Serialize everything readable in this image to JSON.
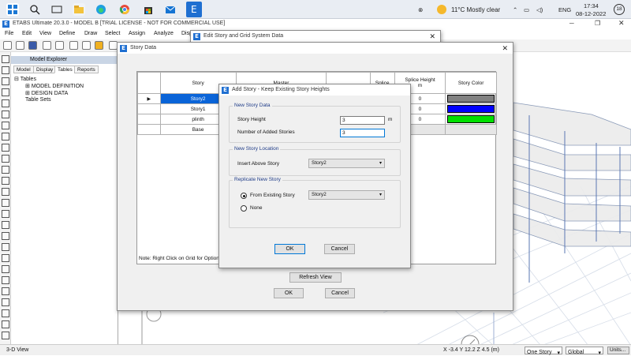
{
  "taskbar": {
    "weather": "11°C  Mostly clear",
    "language": "ENG",
    "time": "17:34",
    "date": "08-12-2022",
    "notification_count": "18"
  },
  "app": {
    "title": "ETABS Ultimate 20.3.0 - MODEL B  [TRIAL LICENSE - NOT FOR COMMERCIAL USE]",
    "menus": [
      "File",
      "Edit",
      "View",
      "Define",
      "Draw",
      "Select",
      "Assign",
      "Analyze",
      "Disp"
    ]
  },
  "explorer": {
    "title": "Model Explorer",
    "tabs": [
      "Model",
      "Display",
      "Tables",
      "Reports"
    ],
    "tree": [
      "Tables",
      "MODEL DEFINITION",
      "DESIGN DATA",
      "Table Sets"
    ]
  },
  "edit_story_dialog": {
    "title": "Edit Story and Grid System Data"
  },
  "story_data_dialog": {
    "title": "Story Data",
    "columns": [
      "Story",
      "Master",
      "Splice",
      "Splice Height\nm",
      "Story Color"
    ],
    "rows": [
      {
        "story": "Story2",
        "splice_height": "0",
        "color": "#808080"
      },
      {
        "story": "Story1",
        "splice_height": "0",
        "color": "#0000ff"
      },
      {
        "story": "plinth",
        "splice_height": "0",
        "color": "#00e000"
      },
      {
        "story": "Base",
        "splice_height": "",
        "color": "#e6e6e6"
      }
    ],
    "note": "Note:  Right Click on Grid for Options",
    "refresh_label": "Refresh View",
    "ok_label": "OK",
    "cancel_label": "Cancel"
  },
  "add_story_dialog": {
    "title": "Add Story - Keep Existing Story Heights",
    "new_story_group": "New Story Data",
    "story_height_label": "Story Height",
    "story_height_value": "3",
    "story_height_unit": "m",
    "added_stories_label": "Number of Added Stories",
    "added_stories_value": "3",
    "location_group": "New Story Location",
    "insert_above_label": "Insert Above Story",
    "insert_above_value": "Story2",
    "replicate_group": "Replicate New Story",
    "from_existing_label": "From Existing Story",
    "from_existing_value": "Story2",
    "none_label": "None",
    "ok_label": "OK",
    "cancel_label": "Cancel"
  },
  "statusbar": {
    "view_label": "3-D View",
    "coords": "X -3.4  Y 12.2  Z 4.5 (m)",
    "story_select": "One Story",
    "coord_select": "Global",
    "units_button": "Units..."
  }
}
